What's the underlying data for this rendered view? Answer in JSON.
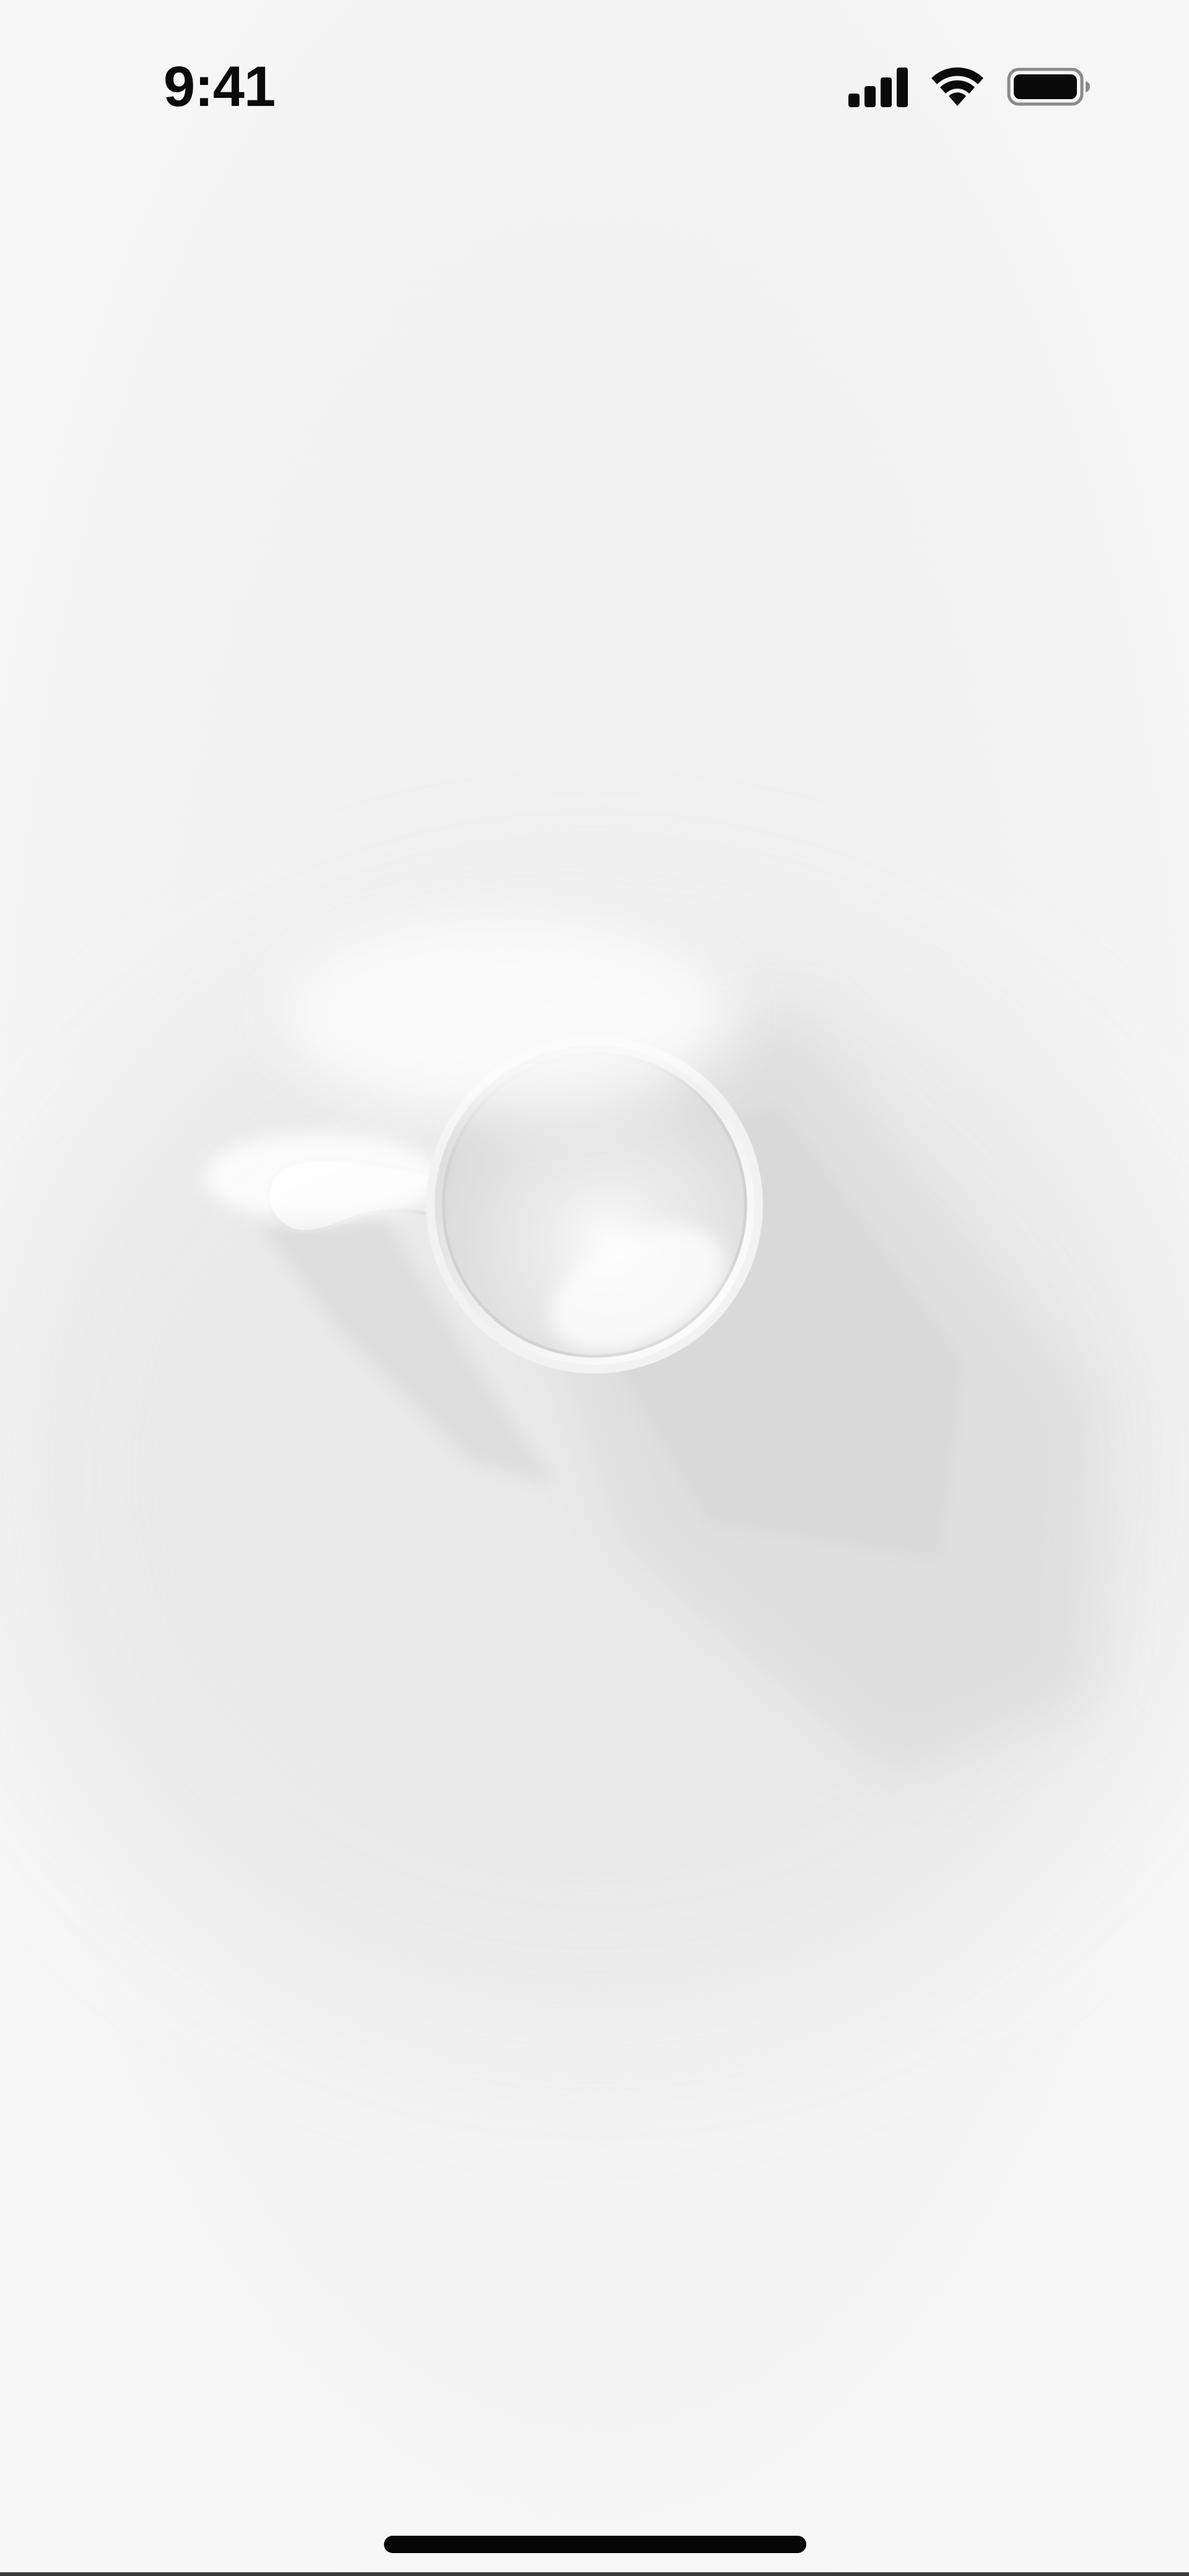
{
  "status_bar": {
    "time": "9:41",
    "icons": [
      "signal-icon",
      "wifi-icon",
      "battery-icon"
    ],
    "text_color": "#0a0a0a"
  },
  "artwork": {
    "subject": "cup-illustration",
    "background_color": "#f6f6f6"
  },
  "home_indicator": {
    "color": "#050505"
  }
}
